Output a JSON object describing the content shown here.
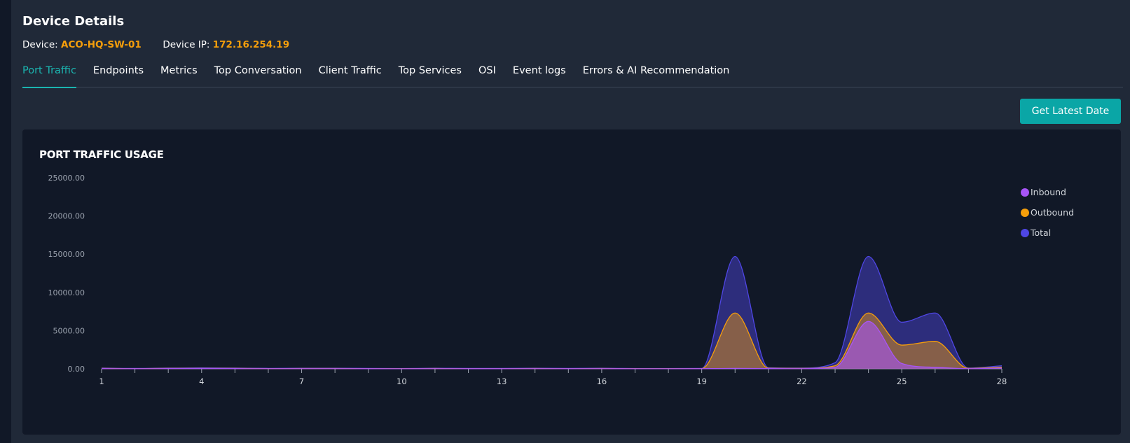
{
  "header": {
    "title": "Device Details",
    "device_label": "Device:",
    "device_value": "ACO-HQ-SW-01",
    "ip_label": "Device IP:",
    "ip_value": "172.16.254.19"
  },
  "tabs": [
    {
      "label": "Port Traffic",
      "active": true
    },
    {
      "label": "Endpoints"
    },
    {
      "label": "Metrics"
    },
    {
      "label": "Top Conversation"
    },
    {
      "label": "Client Traffic"
    },
    {
      "label": "Top Services"
    },
    {
      "label": "OSI"
    },
    {
      "label": "Event logs"
    },
    {
      "label": "Errors & AI Recommendation"
    }
  ],
  "actions": {
    "get_latest_label": "Get Latest Date"
  },
  "colors": {
    "accent": "#1bb5b0",
    "highlight": "#f59e0b",
    "button": "#0aa6a6",
    "inbound": "#a855f7",
    "outbound": "#f59e0b",
    "total": "#4f46e5"
  },
  "chart_data": {
    "type": "area",
    "title": "PORT TRAFFIC USAGE",
    "x": [
      1,
      2,
      3,
      4,
      5,
      6,
      7,
      8,
      9,
      10,
      11,
      12,
      13,
      14,
      15,
      16,
      17,
      18,
      19,
      20,
      21,
      22,
      23,
      24,
      25,
      26,
      27,
      28
    ],
    "x_tick_labels": [
      "1",
      "4",
      "7",
      "10",
      "13",
      "16",
      "19",
      "22",
      "25",
      "28"
    ],
    "x_tick_values": [
      1,
      4,
      7,
      10,
      13,
      16,
      19,
      22,
      25,
      28
    ],
    "ylim": [
      0,
      25000
    ],
    "y_ticks": [
      0,
      5000,
      10000,
      15000,
      20000,
      25000
    ],
    "y_tick_labels": [
      "0.00",
      "5000.00",
      "10000.00",
      "15000.00",
      "20000.00",
      "25000.00"
    ],
    "legend_position": "top-right",
    "series": [
      {
        "name": "Total",
        "color": "#4f46e5",
        "values": [
          100,
          50,
          100,
          120,
          100,
          60,
          80,
          80,
          50,
          40,
          80,
          50,
          50,
          80,
          50,
          80,
          40,
          40,
          50,
          14700,
          150,
          100,
          800,
          14700,
          6100,
          7300,
          100,
          400
        ]
      },
      {
        "name": "Outbound",
        "color": "#f59e0b",
        "values": [
          50,
          25,
          50,
          60,
          50,
          30,
          40,
          40,
          25,
          20,
          40,
          25,
          25,
          40,
          25,
          40,
          20,
          20,
          25,
          7300,
          70,
          50,
          400,
          7300,
          3100,
          3600,
          50,
          200
        ]
      },
      {
        "name": "Inbound",
        "color": "#a855f7",
        "values": [
          30,
          15,
          30,
          40,
          30,
          20,
          25,
          25,
          15,
          10,
          25,
          15,
          15,
          25,
          15,
          25,
          10,
          10,
          15,
          50,
          30,
          20,
          200,
          6200,
          700,
          200,
          20,
          100
        ]
      }
    ]
  }
}
